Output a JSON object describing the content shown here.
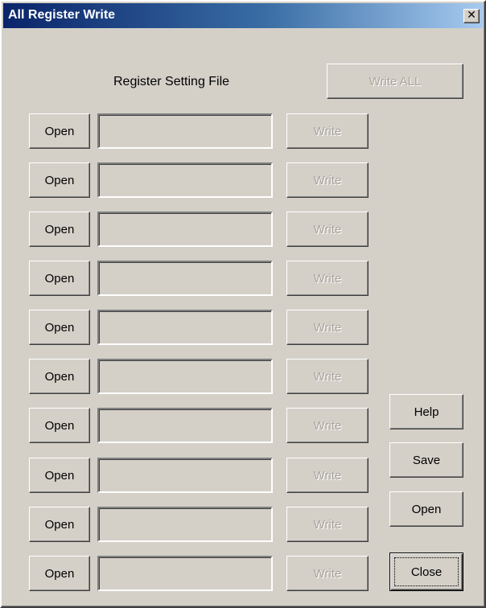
{
  "window": {
    "title": "All Register Write",
    "close_label": "✕"
  },
  "header": {
    "label": "Register Setting File",
    "write_all_label": "Write ALL"
  },
  "rows": [
    {
      "open_label": "Open",
      "path": "",
      "write_label": "Write"
    },
    {
      "open_label": "Open",
      "path": "",
      "write_label": "Write"
    },
    {
      "open_label": "Open",
      "path": "",
      "write_label": "Write"
    },
    {
      "open_label": "Open",
      "path": "",
      "write_label": "Write"
    },
    {
      "open_label": "Open",
      "path": "",
      "write_label": "Write"
    },
    {
      "open_label": "Open",
      "path": "",
      "write_label": "Write"
    },
    {
      "open_label": "Open",
      "path": "",
      "write_label": "Write"
    },
    {
      "open_label": "Open",
      "path": "",
      "write_label": "Write"
    },
    {
      "open_label": "Open",
      "path": "",
      "write_label": "Write"
    },
    {
      "open_label": "Open",
      "path": "",
      "write_label": "Write"
    }
  ],
  "side": {
    "help_label": "Help",
    "save_label": "Save",
    "open_label": "Open",
    "close_label": "Close"
  }
}
